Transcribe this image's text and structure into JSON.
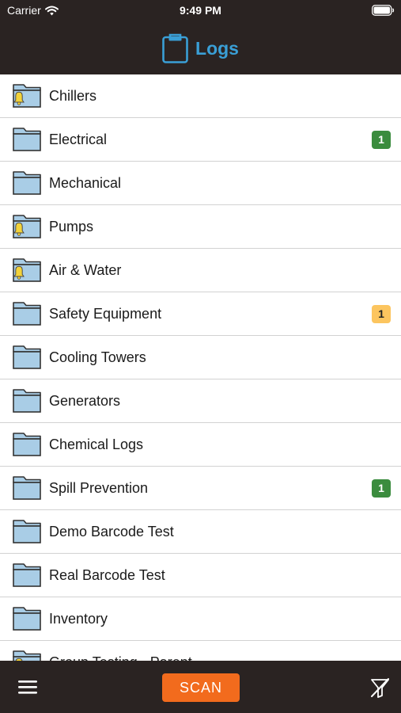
{
  "status_bar": {
    "carrier": "Carrier",
    "time": "9:49 PM"
  },
  "header": {
    "title": "Logs",
    "title_icon": "clipboard-icon",
    "accent_color": "#3a9fd6",
    "background_color": "#2a2322"
  },
  "logs": [
    {
      "label": "Chillers",
      "alert": true,
      "badge": null
    },
    {
      "label": "Electrical",
      "alert": false,
      "badge": "1",
      "badge_color": "#3b8c3e"
    },
    {
      "label": "Mechanical",
      "alert": false,
      "badge": null
    },
    {
      "label": "Pumps",
      "alert": true,
      "badge": null
    },
    {
      "label": "Air & Water",
      "alert": true,
      "badge": null
    },
    {
      "label": "Safety Equipment",
      "alert": false,
      "badge": "1",
      "badge_color": "#fcc55f"
    },
    {
      "label": "Cooling Towers",
      "alert": false,
      "badge": null
    },
    {
      "label": "Generators",
      "alert": false,
      "badge": null
    },
    {
      "label": "Chemical Logs",
      "alert": false,
      "badge": null
    },
    {
      "label": "Spill Prevention",
      "alert": false,
      "badge": "1",
      "badge_color": "#3b8c3e"
    },
    {
      "label": "Demo Barcode Test",
      "alert": false,
      "badge": null
    },
    {
      "label": "Real Barcode Test",
      "alert": false,
      "badge": null
    },
    {
      "label": "Inventory",
      "alert": false,
      "badge": null
    },
    {
      "label": "Group Testing - Parent",
      "alert": true,
      "badge": null
    }
  ],
  "toolbar": {
    "menu_icon": "hamburger-menu-icon",
    "scan_label": "SCAN",
    "scan_color": "#f26b1d",
    "filter_icon": "filter-off-icon"
  },
  "colors": {
    "folder_fill": "#a9cde6",
    "folder_stroke": "#333333",
    "bell": "#f3d33a"
  }
}
